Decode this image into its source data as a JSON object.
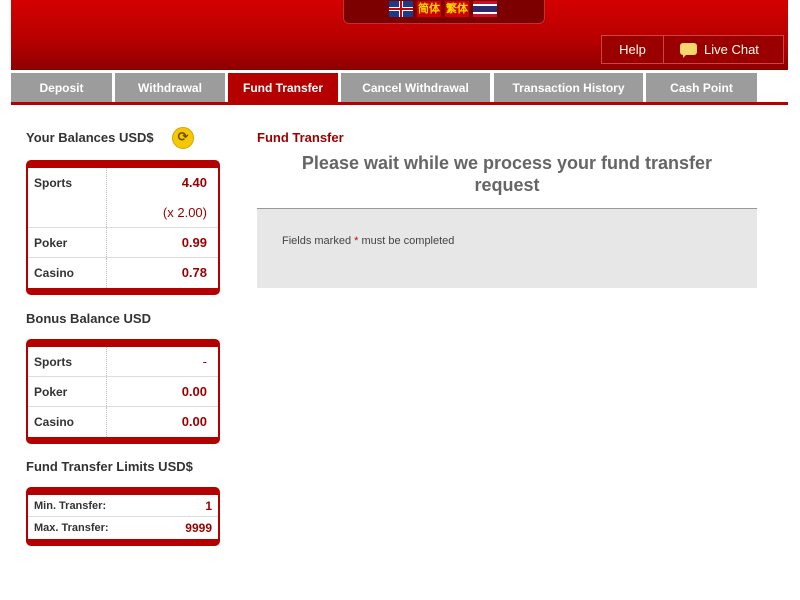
{
  "languages": {
    "english": "English",
    "simplified_chinese": "简体",
    "traditional_chinese": "繁体",
    "thai": "Thai"
  },
  "header": {
    "help_label": "Help",
    "live_chat_label": "Live Chat"
  },
  "tabs": [
    {
      "label": "Deposit",
      "active": false
    },
    {
      "label": "Withdrawal",
      "active": false
    },
    {
      "label": "Fund Transfer",
      "active": true
    },
    {
      "label": "Cancel Withdrawal",
      "active": false
    },
    {
      "label": "Transaction History",
      "active": false
    },
    {
      "label": "Cash Point",
      "active": false
    }
  ],
  "balances": {
    "title": "Your Balances USD$",
    "rows": [
      {
        "label": "Sports",
        "value": "4.40",
        "multiplier": "(x 2.00)"
      },
      {
        "label": "Poker",
        "value": "0.99"
      },
      {
        "label": "Casino",
        "value": "0.78"
      }
    ]
  },
  "bonus": {
    "title": "Bonus Balance USD",
    "rows": [
      {
        "label": "Sports",
        "value": "-"
      },
      {
        "label": "Poker",
        "value": "0.00"
      },
      {
        "label": "Casino",
        "value": "0.00"
      }
    ]
  },
  "limits": {
    "title": "Fund Transfer Limits USD$",
    "rows": [
      {
        "label": "Min. Transfer:",
        "value": "1"
      },
      {
        "label": "Max. Transfer:",
        "value": "9999"
      }
    ]
  },
  "main": {
    "title": "Fund Transfer",
    "heading_line1": "Please wait while we process your fund transfer",
    "heading_line2": "request",
    "note_prefix": "Fields marked ",
    "note_asterisk": "*",
    "note_suffix": " must be completed"
  },
  "colors": {
    "brand_red": "#b50000",
    "tab_gray": "#9c9c9c",
    "value_red": "#9a0000"
  }
}
